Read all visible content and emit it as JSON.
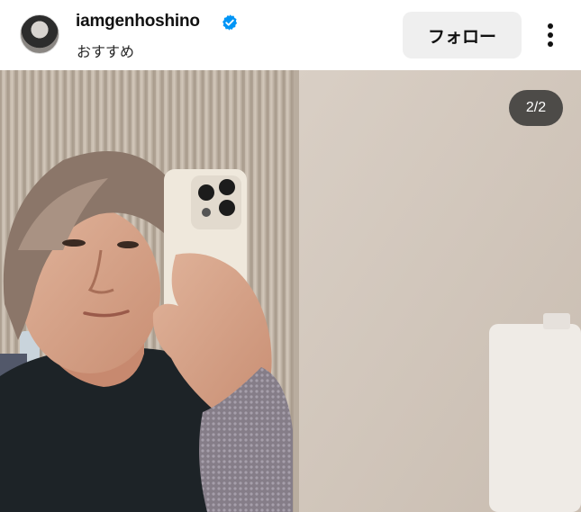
{
  "post": {
    "username": "iamgenhoshino",
    "subtitle": "おすすめ",
    "follow_label": "フォロー",
    "counter": "2/2",
    "icons": [
      "verified-badge-icon",
      "more-options-icon"
    ],
    "colors": {
      "verified": "#0095f6",
      "follow_bg": "#efefef",
      "counter_bg": "#333333"
    }
  }
}
